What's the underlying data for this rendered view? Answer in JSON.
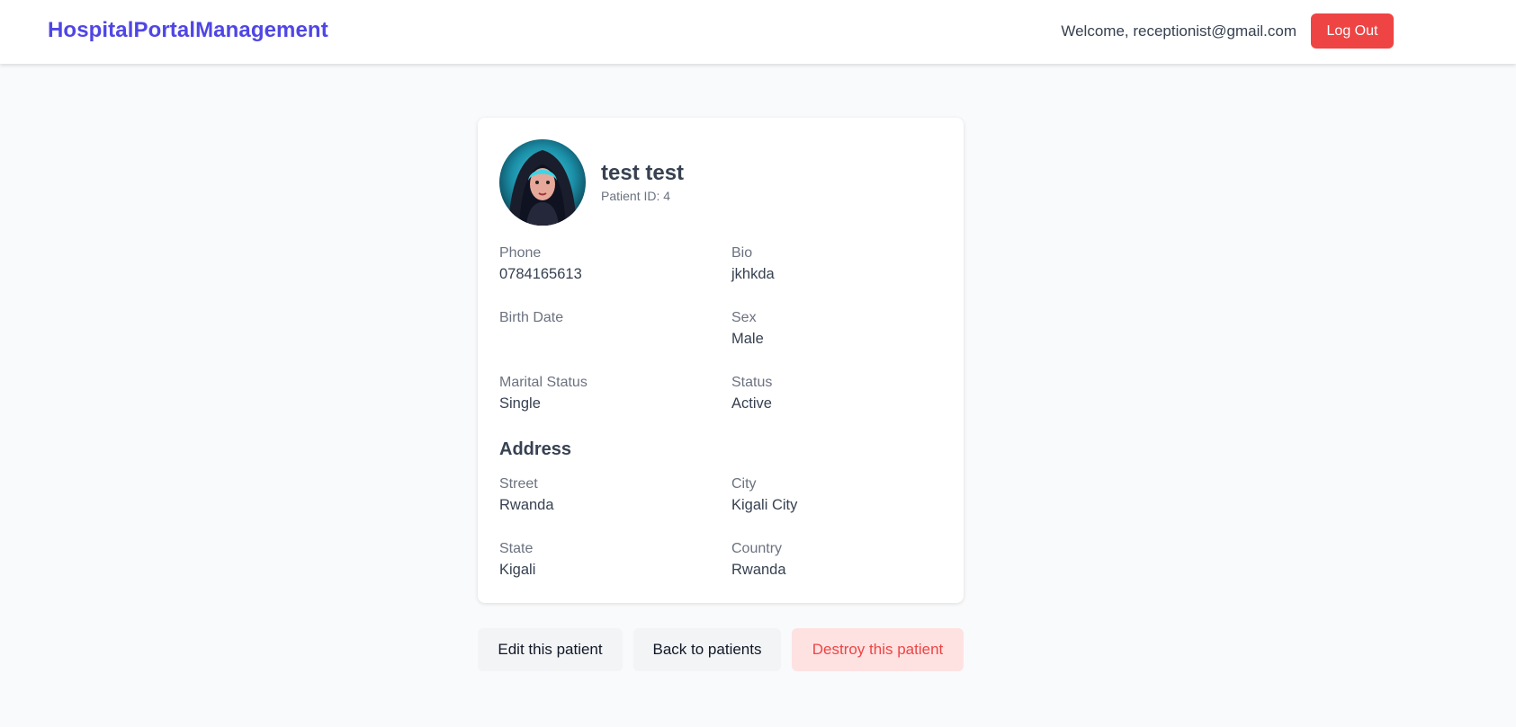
{
  "header": {
    "brand": "HospitalPortalManagement",
    "welcome": "Welcome, receptionist@gmail.com",
    "logout_label": "Log Out"
  },
  "patient": {
    "name": "test test",
    "patient_id": "Patient ID: 4",
    "fields": {
      "phone_label": "Phone",
      "phone": "0784165613",
      "bio_label": "Bio",
      "bio": "jkhkda",
      "birth_date_label": "Birth Date",
      "birth_date": "",
      "sex_label": "Sex",
      "sex": "Male",
      "marital_label": "Marital Status",
      "marital": "Single",
      "status_label": "Status",
      "status": "Active"
    },
    "address": {
      "heading": "Address",
      "street_label": "Street",
      "street": "Rwanda",
      "city_label": "City",
      "city": "Kigali City",
      "state_label": "State",
      "state": "Kigali",
      "country_label": "Country",
      "country": "Rwanda"
    }
  },
  "actions": {
    "edit_label": "Edit this patient",
    "back_label": "Back to patients",
    "destroy_label": "Destroy this patient"
  },
  "colors": {
    "brand": "#4f46e5",
    "danger": "#ef4444",
    "danger_bg": "#fee2e2",
    "neutral_btn": "#f3f4f6"
  },
  "avatar_icon": "user-avatar-image"
}
